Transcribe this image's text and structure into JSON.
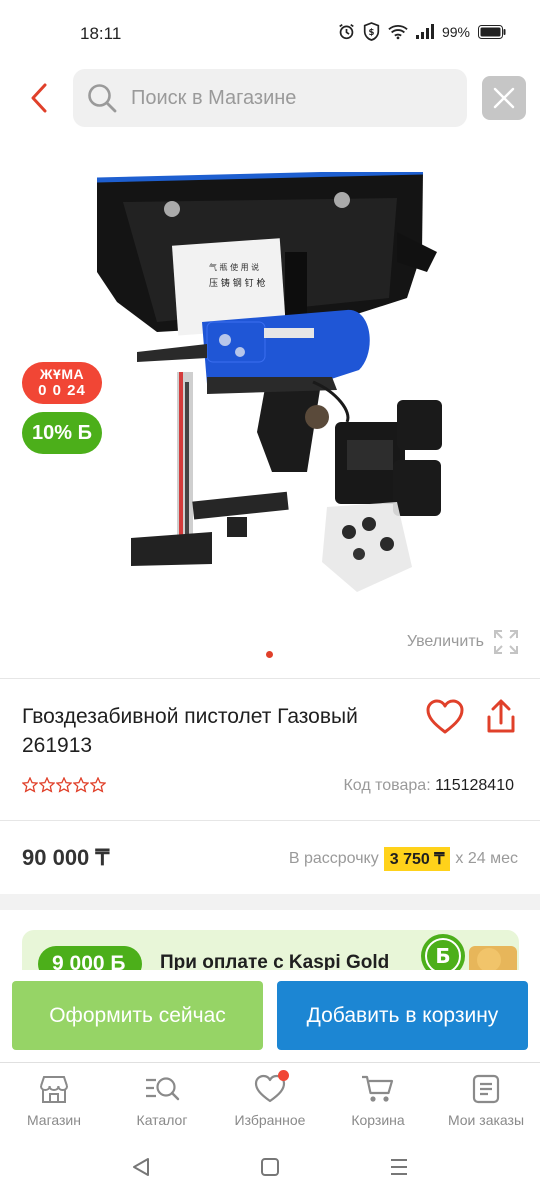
{
  "status_bar": {
    "time": "18:11",
    "battery": "99%",
    "icons": [
      "alarm-icon",
      "shield-icon",
      "wifi-icon",
      "signal-icon",
      "battery-icon"
    ]
  },
  "header": {
    "search_placeholder": "Поиск в Магазине",
    "icons": [
      "back-arrow-icon",
      "search-icon",
      "close-icon"
    ]
  },
  "gallery": {
    "promo_badge_line1": "ЖҰМА",
    "promo_badge_line2": "0 0 24",
    "bonus_badge": "10% Б",
    "zoom_label": "Увеличить"
  },
  "product": {
    "title": "Гвоздезабивной пистолет Газовый 261913",
    "rating_stars": 0,
    "sku_label": "Код товара:",
    "sku_value": "115128410",
    "price": "90 000 ₸",
    "installment_prefix": "В рассрочку",
    "installment_amount": "3 750 ₸",
    "installment_suffix": "х 24 мес"
  },
  "banner": {
    "bonus_pill": "9 000 Б",
    "text": "При оплате с Kaspi Gold"
  },
  "actions": {
    "buy_now": "Оформить сейчас",
    "add_to_cart": "Добавить в корзину"
  },
  "bottom_nav": [
    {
      "label": "Магазин",
      "icon": "shop-icon"
    },
    {
      "label": "Каталог",
      "icon": "catalog-search-icon"
    },
    {
      "label": "Избранное",
      "icon": "heart-icon"
    },
    {
      "label": "Корзина",
      "icon": "cart-icon"
    },
    {
      "label": "Мои заказы",
      "icon": "orders-icon"
    }
  ],
  "colors": {
    "accent_red": "#f14635",
    "kaspi_green": "#4caf1a",
    "buy_button": "#96d466",
    "cart_button": "#1c86d3",
    "installment_highlight": "#ffd21a"
  }
}
